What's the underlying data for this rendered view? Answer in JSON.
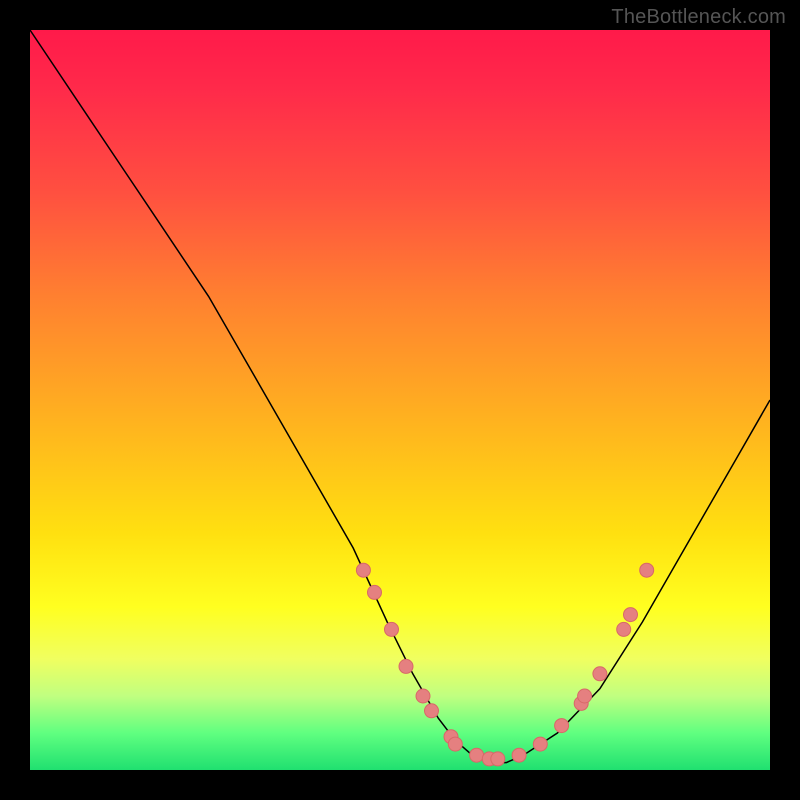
{
  "watermark": "TheBottleneck.com",
  "chart_data": {
    "type": "line",
    "title": "",
    "xlabel": "",
    "ylabel": "",
    "xlim": [
      13,
      100
    ],
    "ylim": [
      0,
      100
    ],
    "legend": false,
    "grid": false,
    "background": "gradient-red-to-green",
    "series": [
      {
        "name": "curve",
        "x": [
          13,
          20,
          27,
          34,
          40,
          46,
          51,
          55,
          58,
          61,
          63,
          65,
          67,
          69,
          71,
          75,
          80,
          85,
          90,
          96,
          100
        ],
        "values": [
          100,
          88,
          76,
          64,
          52,
          40,
          30,
          20,
          13,
          7,
          4,
          2,
          1,
          1,
          2,
          5,
          11,
          20,
          30,
          42,
          50
        ]
      }
    ],
    "markers": [
      {
        "x": 52.2,
        "y": 27
      },
      {
        "x": 53.5,
        "y": 24
      },
      {
        "x": 55.5,
        "y": 19
      },
      {
        "x": 57.2,
        "y": 14
      },
      {
        "x": 59.2,
        "y": 10
      },
      {
        "x": 60.2,
        "y": 8
      },
      {
        "x": 62.5,
        "y": 4.5
      },
      {
        "x": 63.0,
        "y": 3.5
      },
      {
        "x": 65.5,
        "y": 2
      },
      {
        "x": 67.0,
        "y": 1.5
      },
      {
        "x": 68.0,
        "y": 1.5
      },
      {
        "x": 70.5,
        "y": 2
      },
      {
        "x": 73.0,
        "y": 3.5
      },
      {
        "x": 75.5,
        "y": 6
      },
      {
        "x": 77.8,
        "y": 9
      },
      {
        "x": 78.2,
        "y": 10
      },
      {
        "x": 80.0,
        "y": 13
      },
      {
        "x": 82.8,
        "y": 19
      },
      {
        "x": 83.6,
        "y": 21
      },
      {
        "x": 85.5,
        "y": 27
      }
    ]
  }
}
